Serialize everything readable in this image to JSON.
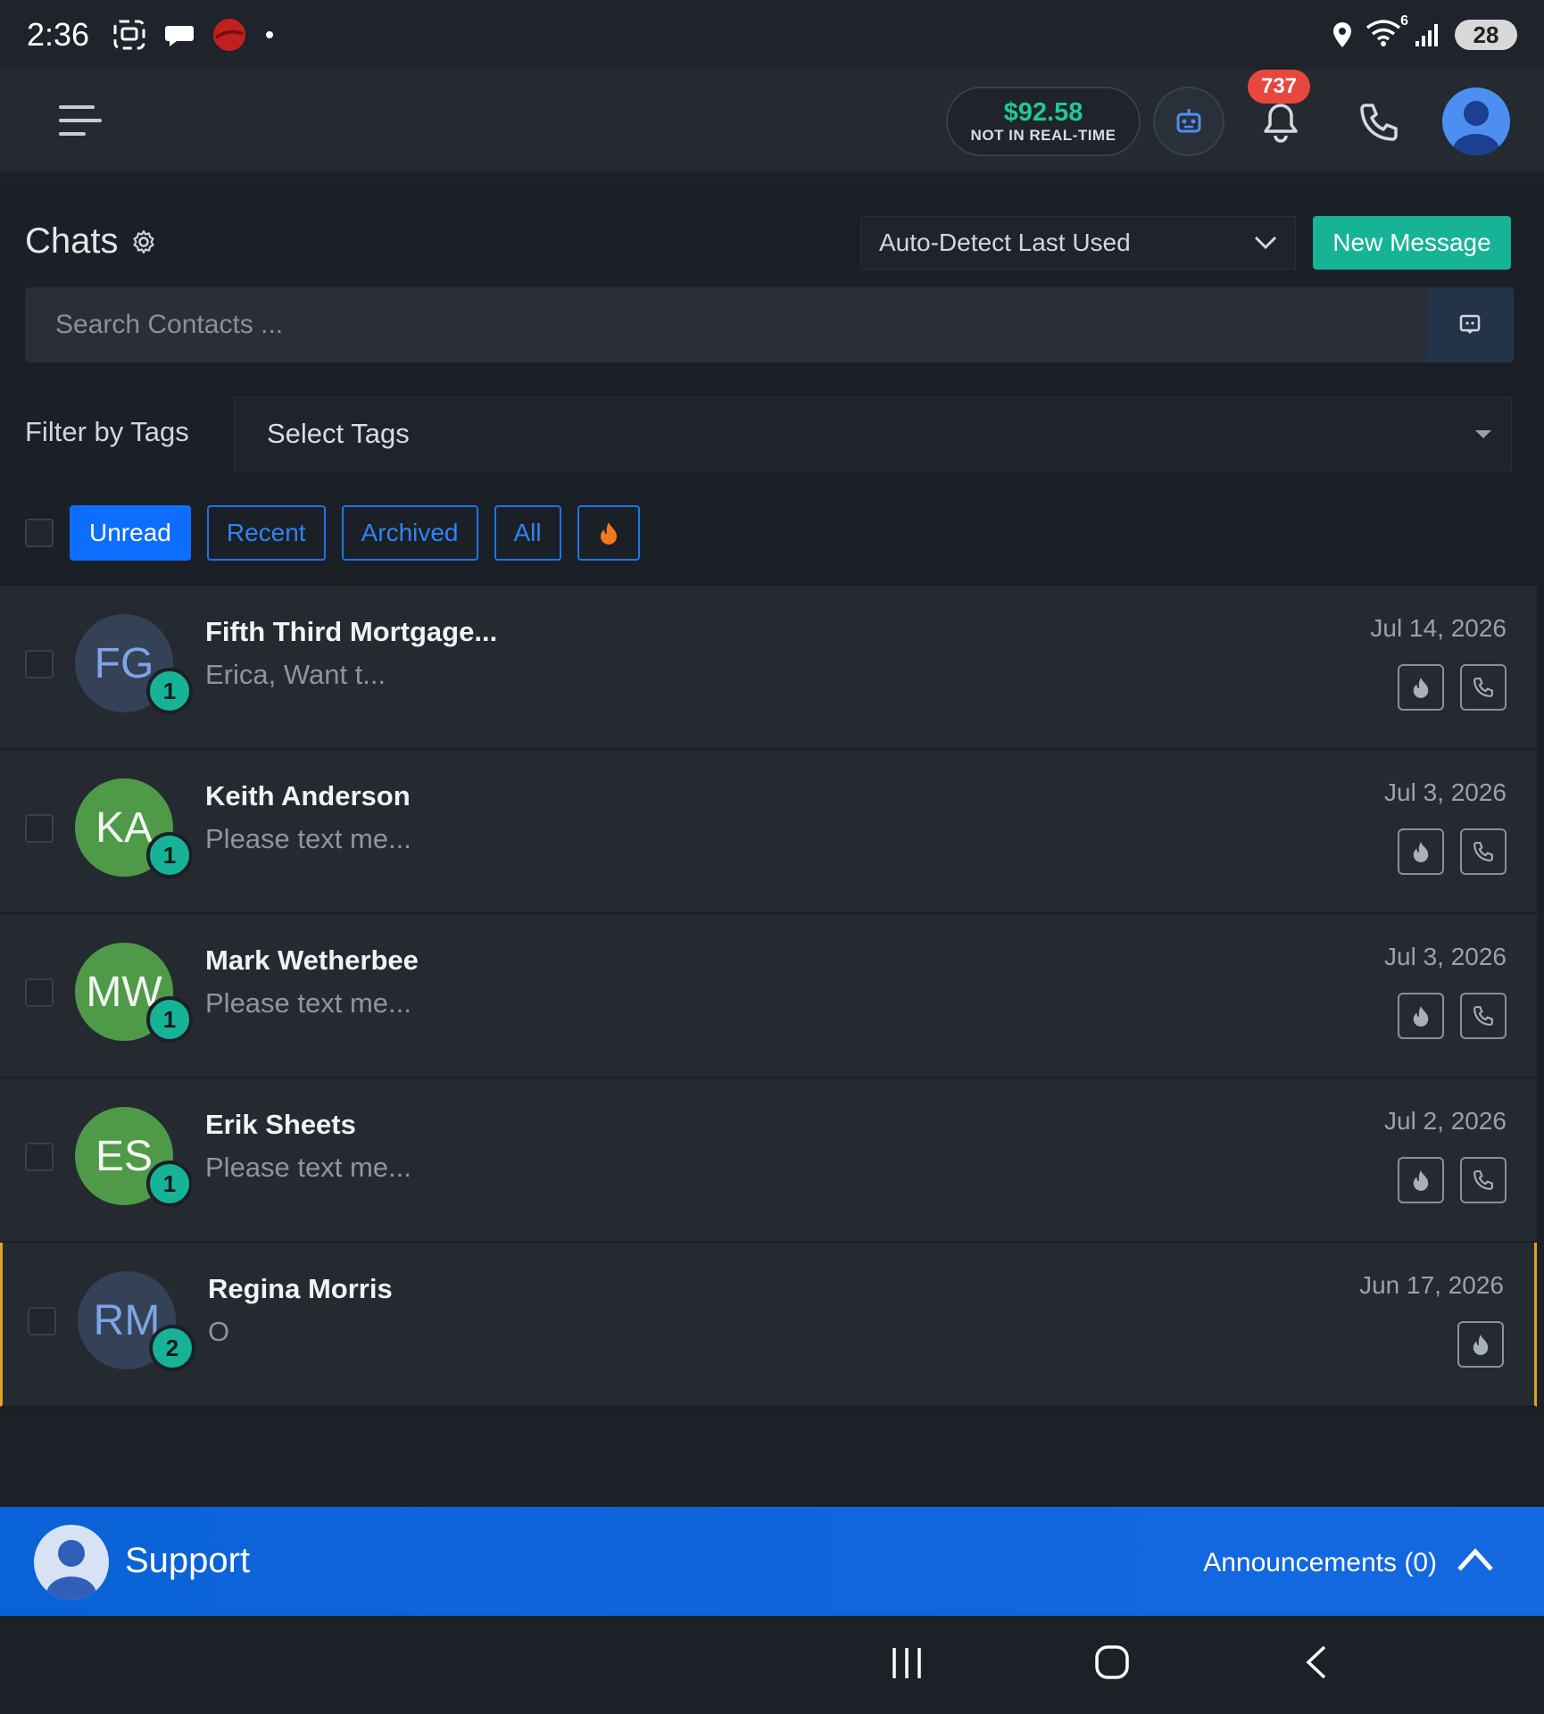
{
  "status_bar": {
    "time": "2:36",
    "battery": "28",
    "icons_left": [
      "screenshot-icon",
      "chat-bubble-icon",
      "app-red-icon",
      "dot-icon"
    ],
    "icons_right": [
      "location-icon",
      "wifi-icon",
      "signal-icon",
      "battery-icon"
    ],
    "wifi_label": "6"
  },
  "app_bar": {
    "balance_amount": "$92.58",
    "balance_note": "NOT IN REAL-TIME",
    "notification_count": "737"
  },
  "chats": {
    "title": "Chats",
    "sender_select": "Auto-Detect Last Used",
    "new_message_label": "New Message",
    "search_placeholder": "Search Contacts ...",
    "filter_label": "Filter by Tags",
    "tags_placeholder": "Select Tags",
    "filters": [
      {
        "label": "Unread",
        "active": true
      },
      {
        "label": "Recent",
        "active": false
      },
      {
        "label": "Archived",
        "active": false
      },
      {
        "label": "All",
        "active": false
      }
    ],
    "items": [
      {
        "initials": "FG",
        "name": "Fifth Third Mortgage...",
        "preview": "Erica, Want t...",
        "date": "Jul 14, 2026",
        "count": "1",
        "avatar_color": "blue",
        "has_call": true
      },
      {
        "initials": "KA",
        "name": "Keith Anderson",
        "preview": "Please text me...",
        "date": "Jul 3, 2026",
        "count": "1",
        "avatar_color": "green",
        "has_call": true
      },
      {
        "initials": "MW",
        "name": "Mark Wetherbee",
        "preview": "Please text me...",
        "date": "Jul 3, 2026",
        "count": "1",
        "avatar_color": "green",
        "has_call": true
      },
      {
        "initials": "ES",
        "name": "Erik Sheets",
        "preview": "Please text me...",
        "date": "Jul 2, 2026",
        "count": "1",
        "avatar_color": "green",
        "has_call": true
      },
      {
        "initials": "RM",
        "name": "Regina Morris",
        "preview": "O",
        "date": "Jun 17, 2026",
        "count": "2",
        "avatar_color": "blue",
        "has_call": false
      }
    ]
  },
  "support": {
    "title": "Support",
    "announcements": "Announcements (0)"
  },
  "colors": {
    "accent_teal": "#17b397",
    "primary_blue": "#0d6efd",
    "badge_red": "#e8473d",
    "flag_orange": "#e0a422"
  }
}
